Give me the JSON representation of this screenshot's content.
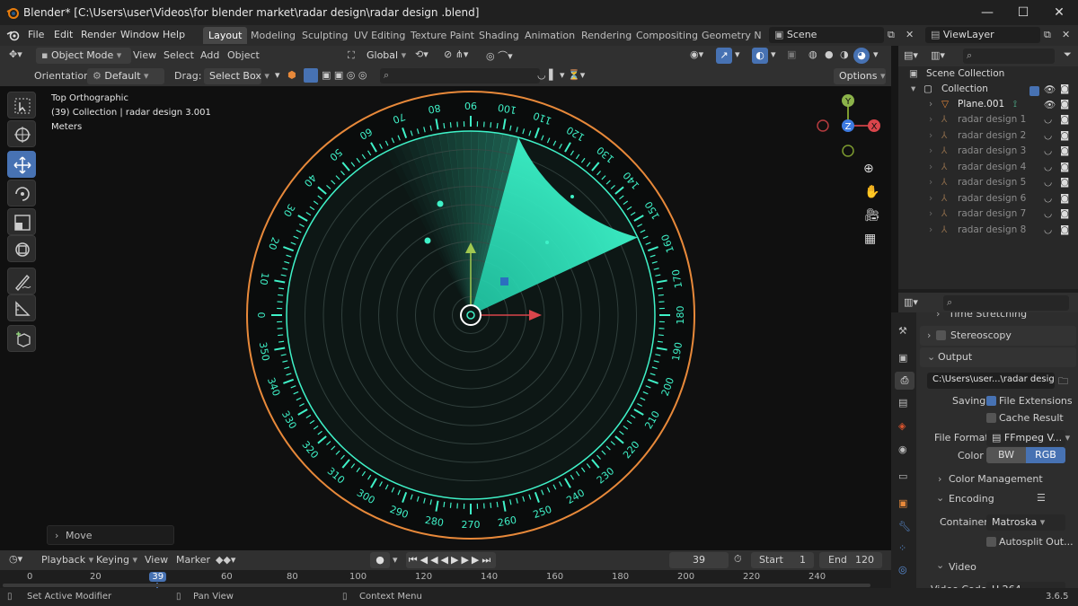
{
  "titlebar": {
    "title": "Blender* [C:\\Users\\user\\Videos\\for blender market\\radar design\\radar design .blend]",
    "minimize": "—",
    "maximize": "☐",
    "close": "✕"
  },
  "menu": {
    "items": [
      "File",
      "Edit",
      "Render",
      "Window",
      "Help"
    ],
    "workspaces": [
      "Layout",
      "Modeling",
      "Sculpting",
      "UV Editing",
      "Texture Paint",
      "Shading",
      "Animation",
      "Rendering",
      "Compositing",
      "Geometry Noc"
    ],
    "scene": "Scene",
    "view_layer": "ViewLayer"
  },
  "header": {
    "mode": "Object Mode",
    "view": "View",
    "select": "Select",
    "add": "Add",
    "object": "Object",
    "transform": "Global",
    "orientation_label": "Orientation:",
    "orientation": "Default",
    "drag_label": "Drag:",
    "drag": "Select Box",
    "options": "Options"
  },
  "viewport": {
    "line1": "Top Orthographic",
    "line2": "(39) Collection | radar design 3.001",
    "line3": "Meters",
    "operator_panel": "Move",
    "gizmo_y": "Y",
    "gizmo_x": "X",
    "gizmo_z": "Z",
    "radar_color": "#3ff2c8",
    "ring_color": "#e8893a",
    "dial_labels": [
      "0",
      "10",
      "20",
      "30",
      "40",
      "50",
      "60",
      "70",
      "80",
      "90",
      "100",
      "110",
      "120",
      "130",
      "140",
      "150",
      "160",
      "170",
      "180",
      "190",
      "200",
      "210",
      "220",
      "230",
      "240",
      "250",
      "260",
      "270",
      "280",
      "290",
      "300",
      "310",
      "320",
      "330",
      "340",
      "350"
    ]
  },
  "outliner": {
    "scene_collection": "Scene Collection",
    "collection": "Collection",
    "items": [
      "Plane.001",
      "radar design 1",
      "radar design 2",
      "radar design 3",
      "radar design 4",
      "radar design 5",
      "radar design 6",
      "radar design 7",
      "radar design 8"
    ]
  },
  "properties": {
    "time_stretching": "Time Stretching",
    "stereoscopy": "Stereoscopy",
    "output": "Output",
    "output_path": "C:\\Users\\user...\\radar design\\",
    "saving_label": "Saving",
    "file_extensions": "File Extensions",
    "cache_result": "Cache Result",
    "file_format_label": "File Format",
    "file_format": "FFmpeg V...",
    "color_label": "Color",
    "color_bw": "BW",
    "color_rgb": "RGB",
    "color_management": "Color Management",
    "encoding": "Encoding",
    "container_label": "Container",
    "container": "Matroska",
    "autosplit": "Autosplit Out...",
    "video": "Video",
    "video_codec_label": "Video Codec",
    "video_codec": "H.264"
  },
  "timeline": {
    "playback": "Playback",
    "keying": "Keying",
    "view": "View",
    "marker": "Marker",
    "current_frame": "39",
    "start_label": "Start",
    "start": "1",
    "end_label": "End",
    "end": "120",
    "ticks": [
      "0",
      "20",
      "39",
      "60",
      "80",
      "100",
      "120",
      "140",
      "160",
      "180",
      "200",
      "220",
      "240"
    ]
  },
  "statusbar": {
    "left": "Set Active Modifier",
    "middle": "Pan View",
    "right": "Context Menu",
    "version": "3.6.5"
  }
}
